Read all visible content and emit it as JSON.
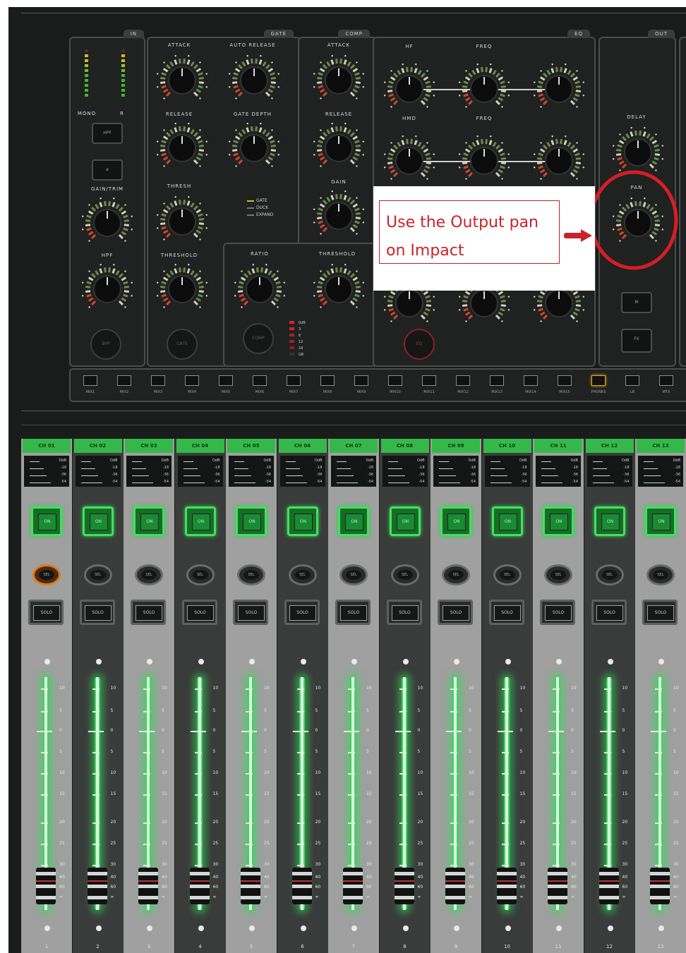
{
  "sections": {
    "input_tab": "IN",
    "gate_tab": "GATE",
    "comp_tab": "COMP",
    "eq_tab": "EQ",
    "output_tab": "OUT"
  },
  "input": {
    "meter_label_left": "MONO",
    "meter_label_right": "R",
    "btn1": "HPF",
    "btn2": "ø",
    "knob1_label": "GAIN/TRIM",
    "knob2_label": "HPF",
    "bypass": "BYP"
  },
  "gate": {
    "labels": [
      "ATTACK",
      "AUTO RELEASE",
      "RELEASE",
      "GATE DEPTH",
      "THRESH",
      "THRESHOLD"
    ],
    "options": [
      "GATE",
      "DUCK",
      "EXPAND"
    ],
    "button": "GATE"
  },
  "comp": {
    "labels": [
      "ATTACK",
      "RELEASE",
      "GAIN",
      "RATIO",
      "THRESHOLD"
    ],
    "button": "COMP",
    "gr_scale": [
      "0dB",
      "3",
      "6",
      "12",
      "18",
      "GR"
    ]
  },
  "eq": {
    "labels": [
      "HF",
      "FREQ",
      "HMD",
      "FREQ"
    ],
    "button": "EQ"
  },
  "output": {
    "delay_label": "DELAY",
    "pan_label": "PAN",
    "btn1": "M",
    "btn2": "FX"
  },
  "assign_bar": [
    "MIX1",
    "MIX2",
    "MIX3",
    "MIX4",
    "MIX5",
    "MIX6",
    "MIX7",
    "MIX8",
    "MIX9",
    "MIX10",
    "MIX11",
    "MIX12",
    "MIX13",
    "MIX14",
    "MIX15",
    "PHONES",
    "LR",
    "MTX"
  ],
  "callout": {
    "line1": "Use the Output pan",
    "line2": "on Impact"
  },
  "channel_labels": {
    "on": "ON",
    "sel": "SEL",
    "solo": "SOLO"
  },
  "channels": [
    {
      "name": "CH 01",
      "number": "1",
      "selected": true
    },
    {
      "name": "CH 02",
      "number": "2",
      "selected": false
    },
    {
      "name": "CH 03",
      "number": "3",
      "selected": false
    },
    {
      "name": "CH 04",
      "number": "4",
      "selected": false
    },
    {
      "name": "CH 05",
      "number": "5",
      "selected": false
    },
    {
      "name": "CH 06",
      "number": "6",
      "selected": false
    },
    {
      "name": "CH 07",
      "number": "7",
      "selected": false
    },
    {
      "name": "CH 08",
      "number": "8",
      "selected": false
    },
    {
      "name": "CH 09",
      "number": "9",
      "selected": false
    },
    {
      "name": "CH 10",
      "number": "10",
      "selected": false
    },
    {
      "name": "CH 11",
      "number": "11",
      "selected": false
    },
    {
      "name": "CH 12",
      "number": "12",
      "selected": false
    },
    {
      "name": "CH 13",
      "number": "13",
      "selected": false
    }
  ],
  "fader_scale": [
    "10",
    "5",
    "0",
    "5",
    "10",
    "15",
    "20",
    "25",
    "30",
    "40",
    "60",
    "∞"
  ],
  "mini_meter_scale": [
    "OdB",
    "-18",
    "-36",
    "-54"
  ],
  "colors": {
    "accent_green": "#35b84a",
    "selected_orange": "#e07a1c",
    "annotation_red": "#c8232a",
    "background": "#1a1b1b"
  }
}
